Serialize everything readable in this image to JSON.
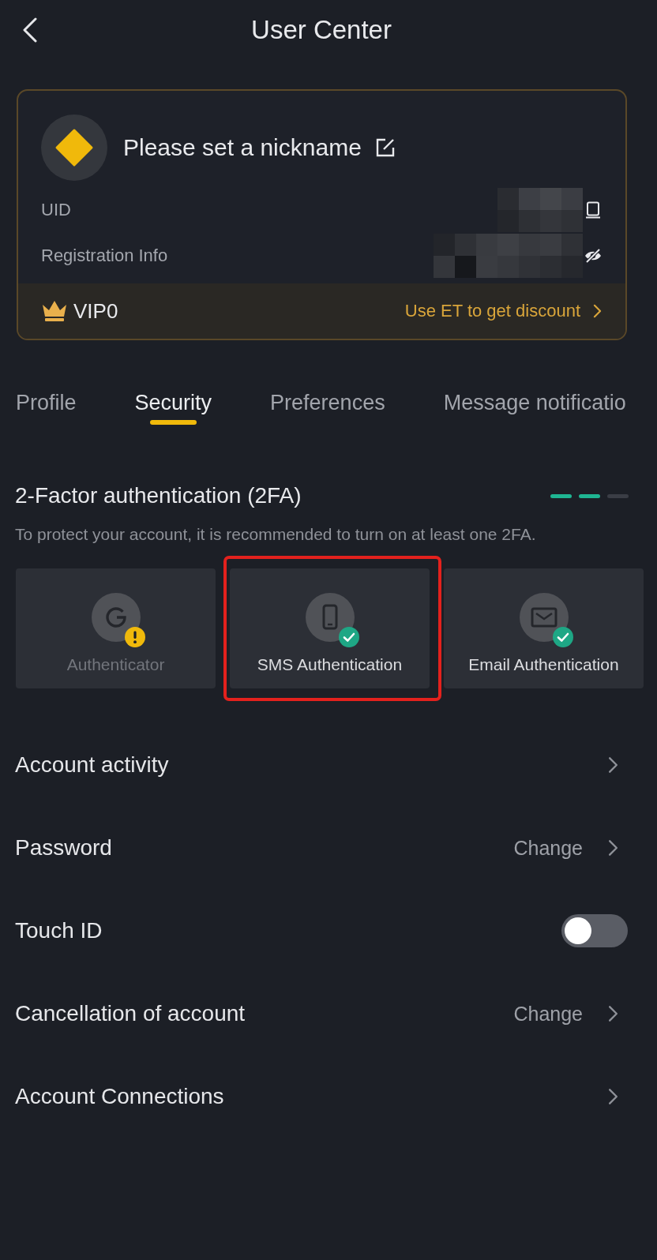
{
  "header": {
    "title": "User Center"
  },
  "profile": {
    "nickname": "Please set a nickname",
    "fields": [
      {
        "label": "UID",
        "kind": "copyable",
        "redacted": true
      },
      {
        "label": "Registration Info",
        "kind": "concealed",
        "redacted": true
      }
    ],
    "vip": {
      "level_label": "VIP0",
      "promo": "Use ET to get discount"
    }
  },
  "tabs": [
    {
      "label": "Profile",
      "selected": false
    },
    {
      "label": "Security",
      "selected": true
    },
    {
      "label": "Preferences",
      "selected": false
    },
    {
      "label": "Message notificatio",
      "selected": false
    }
  ],
  "two_factor": {
    "title": "2-Factor authentication (2FA)",
    "meter": {
      "level": 0.67
    },
    "description": "To protect your account, it is recommended to turn on at least one 2FA.",
    "methods": [
      {
        "label": "Authenticator",
        "kind": "authenticator",
        "enabled": false,
        "highlighted": false
      },
      {
        "label": "SMS Authentication",
        "kind": "sms",
        "enabled": true,
        "highlighted": true
      },
      {
        "label": "Email Authentication",
        "kind": "email",
        "enabled": true,
        "highlighted": false
      }
    ]
  },
  "settings": [
    {
      "label": "Account activity",
      "kind": "link"
    },
    {
      "label": "Password",
      "kind": "link",
      "value": "Change"
    },
    {
      "label": "Touch ID",
      "kind": "toggle",
      "on": false
    },
    {
      "label": "Cancellation of account",
      "kind": "link",
      "value": "Change"
    },
    {
      "label": "Account Connections",
      "kind": "link"
    }
  ]
}
